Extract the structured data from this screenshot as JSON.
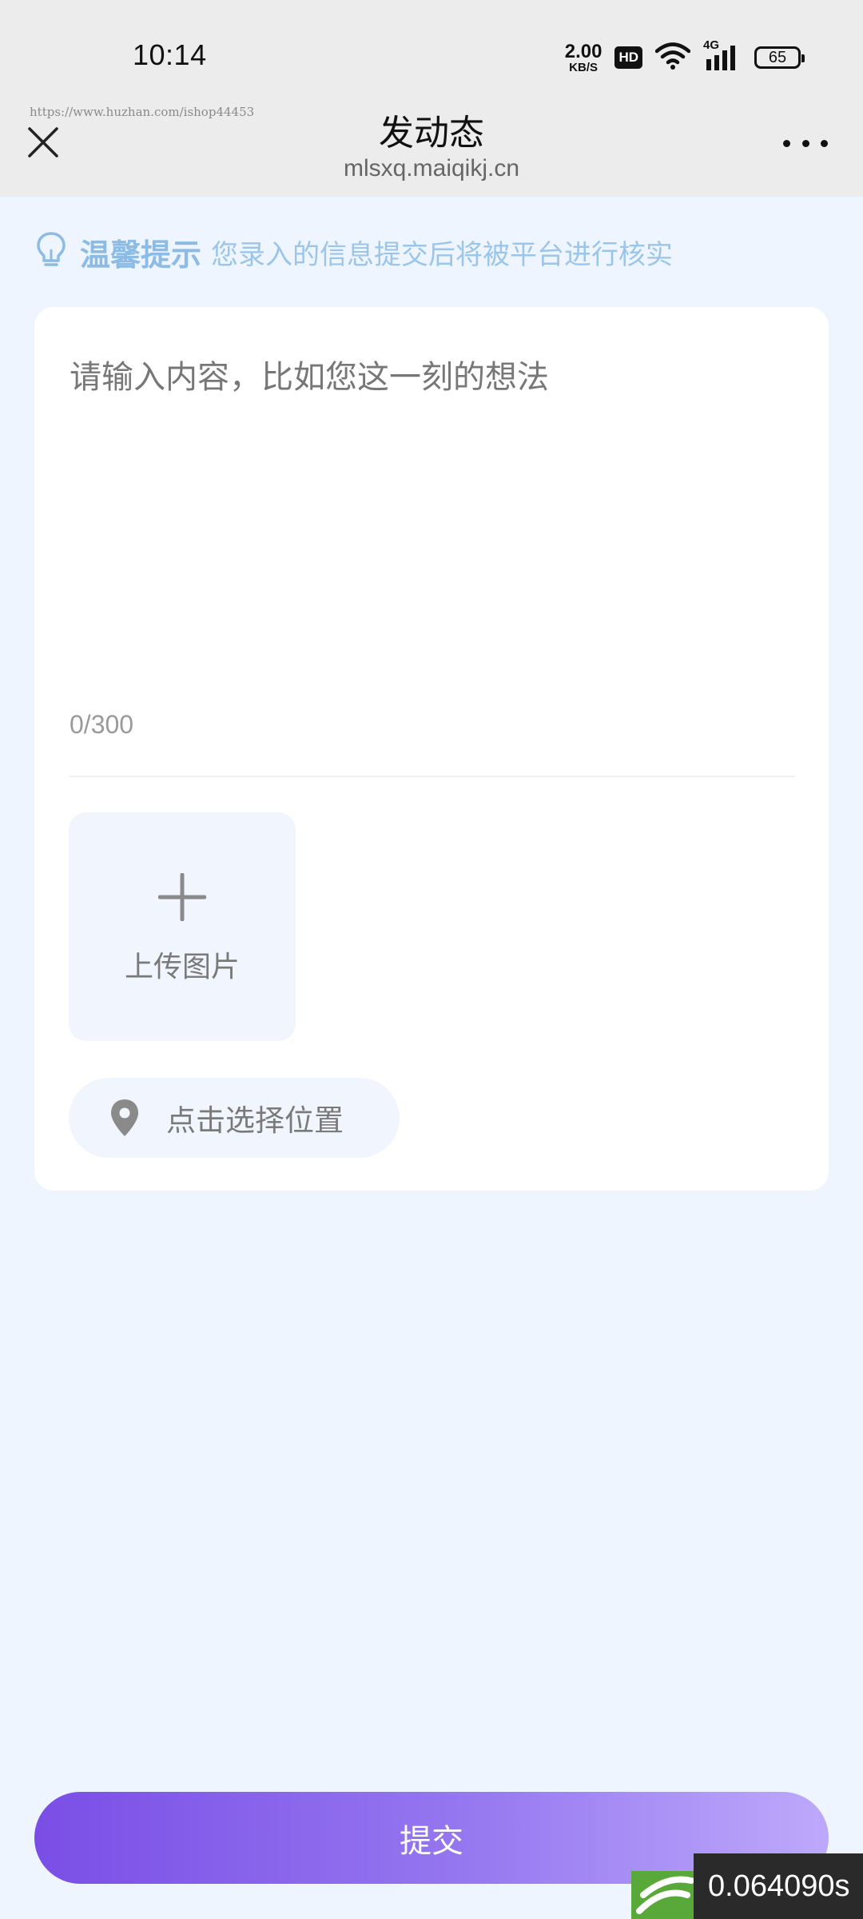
{
  "status_bar": {
    "time": "10:14",
    "net_speed_value": "2.00",
    "net_speed_unit": "KB/S",
    "hd_badge": "HD",
    "network": "4G",
    "battery": "65"
  },
  "header": {
    "watermark_url": "https://www.huzhan.com/ishop44453",
    "title": "发动态",
    "domain": "mlsxq.maiqikj.cn"
  },
  "tip": {
    "title": "温馨提示",
    "text": "您录入的信息提交后将被平台进行核实"
  },
  "form": {
    "content_placeholder": "请输入内容，比如您这一刻的想法",
    "content_value": "",
    "char_count": "0/300",
    "upload_label": "上传图片",
    "location_label": "点击选择位置"
  },
  "submit_label": "提交",
  "overlay": {
    "timer_text": "0.064090s"
  },
  "colors": {
    "page_background": "#eef5fe",
    "tip_color": "#8cbce6",
    "submit_gradient_start": "#7a4ee6",
    "submit_gradient_end": "#bda9fb"
  }
}
